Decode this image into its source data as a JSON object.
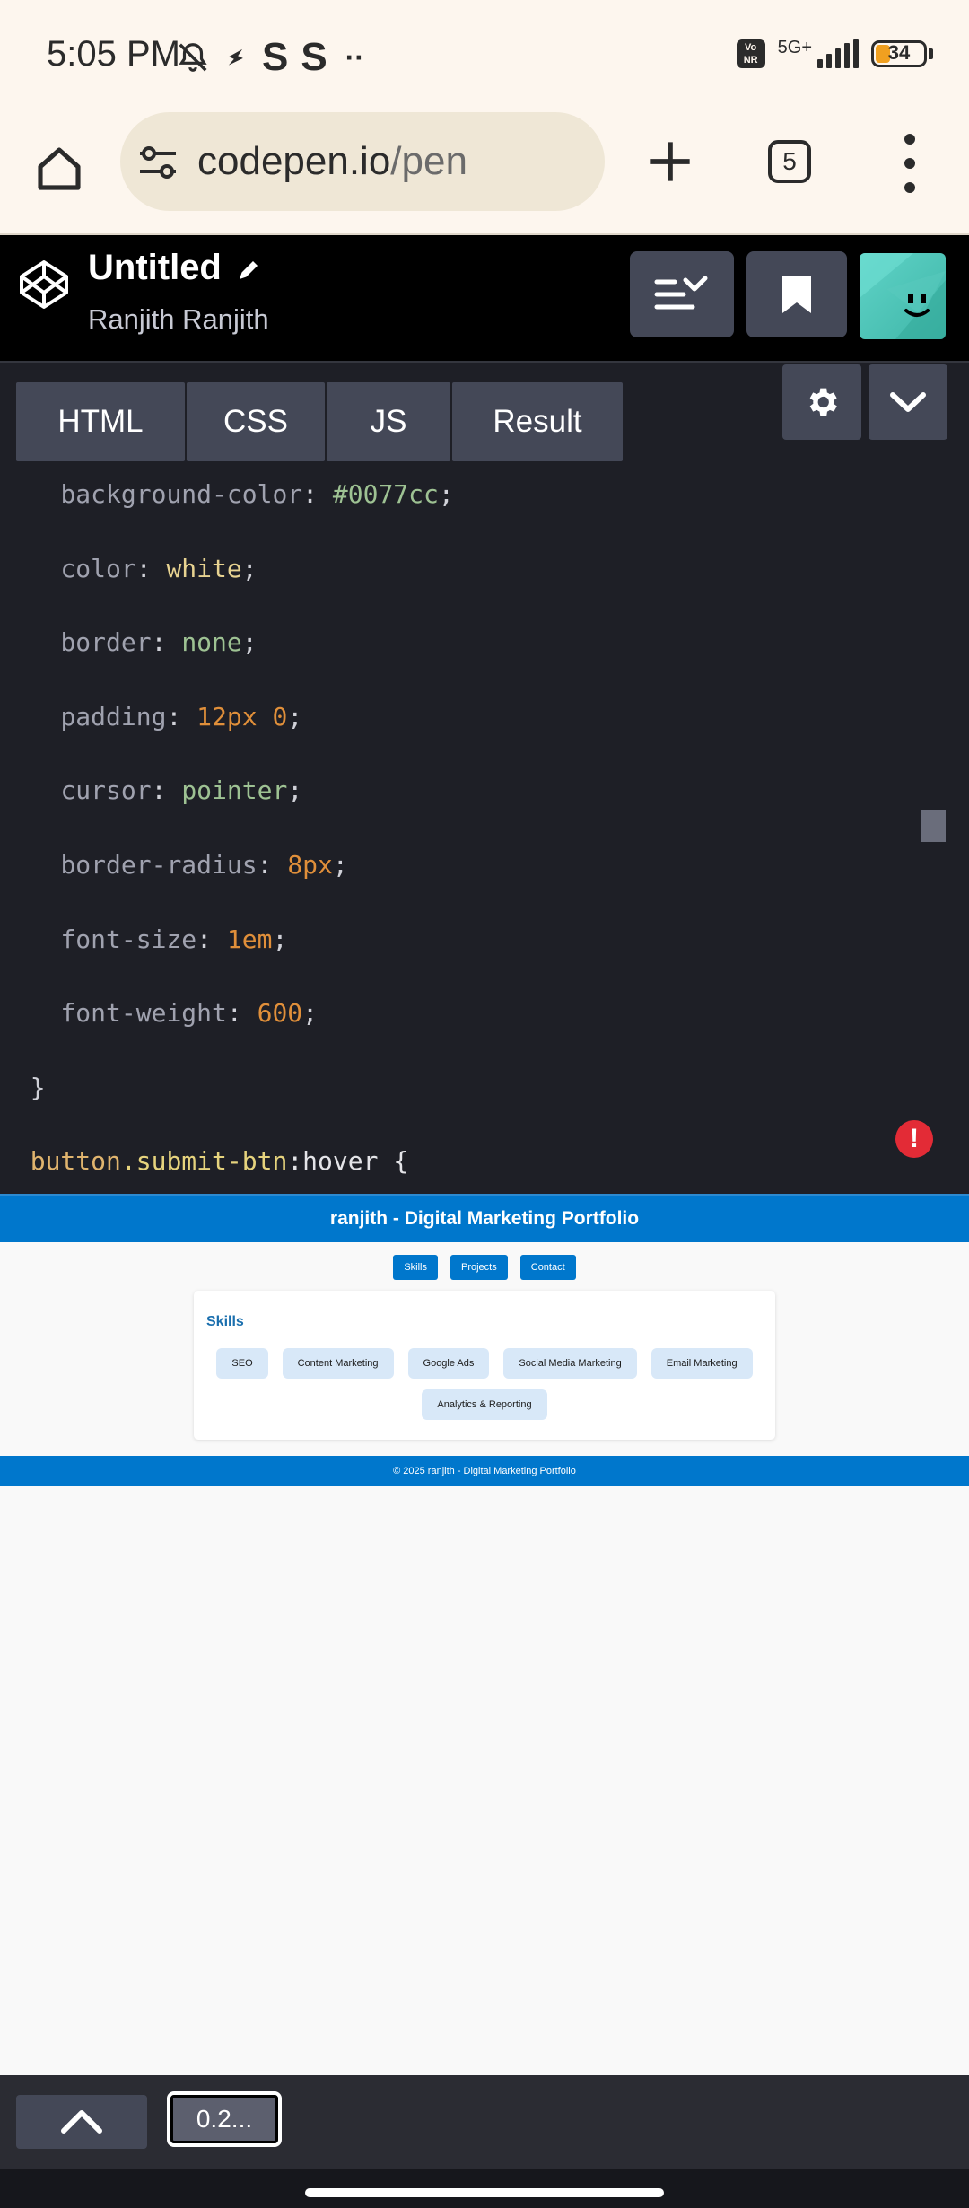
{
  "status_bar": {
    "time": "5:05 PM",
    "left_icons": [
      "bell-off-icon",
      "bolt-icon",
      "s-app-icon",
      "s-app-icon",
      "more-dots-icon"
    ],
    "s_icon_glyph": "S",
    "more_glyph": "··",
    "volte_label": "Vo NR",
    "network_label": "5G+",
    "battery_level": "34"
  },
  "browser": {
    "url_domain": "codepen.io",
    "url_path": "/pen",
    "tab_count": "5"
  },
  "codepen": {
    "title": "Untitled",
    "author": "Ranjith Ranjith"
  },
  "editor": {
    "tabs": [
      {
        "label": "HTML"
      },
      {
        "label": "CSS"
      },
      {
        "label": "JS"
      },
      {
        "label": "Result"
      }
    ],
    "code_lines": [
      {
        "prop": "background-color",
        "value": "#0077cc"
      },
      {
        "prop": "color",
        "value": "white"
      },
      {
        "prop": "border",
        "value": "none"
      },
      {
        "prop": "padding",
        "value": "12px 0"
      },
      {
        "prop": "cursor",
        "value": "pointer"
      },
      {
        "prop": "border-radius",
        "value": "8px"
      },
      {
        "prop": "font-size",
        "value": "1em"
      },
      {
        "prop": "font-weight",
        "value": "600"
      }
    ],
    "closing_brace": "}",
    "selector": {
      "tag": "button",
      "class": ".submit-btn",
      "pseudo": ":hover",
      "open": " {"
    },
    "error_glyph": "!"
  },
  "preview": {
    "header_title": "ranjith - Digital Marketing Portfolio",
    "nav": [
      {
        "label": "Skills"
      },
      {
        "label": "Projects"
      },
      {
        "label": "Contact"
      }
    ],
    "card_title": "Skills",
    "skills": [
      {
        "label": "SEO"
      },
      {
        "label": "Content Marketing"
      },
      {
        "label": "Google Ads"
      },
      {
        "label": "Social Media Marketing"
      },
      {
        "label": "Email Marketing"
      },
      {
        "label": "Analytics & Reporting"
      }
    ],
    "footer_text": "© 2025 ranjith - Digital Marketing Portfolio"
  },
  "bottom_bar": {
    "console_label": "0.2..."
  },
  "colors": {
    "codepen_header": "#000000",
    "editor_bg": "#1e1f26",
    "button_gray": "#444857",
    "preview_blue": "#0077cc",
    "chip_blue": "#d8e8f8",
    "error_red": "#e32b36"
  }
}
